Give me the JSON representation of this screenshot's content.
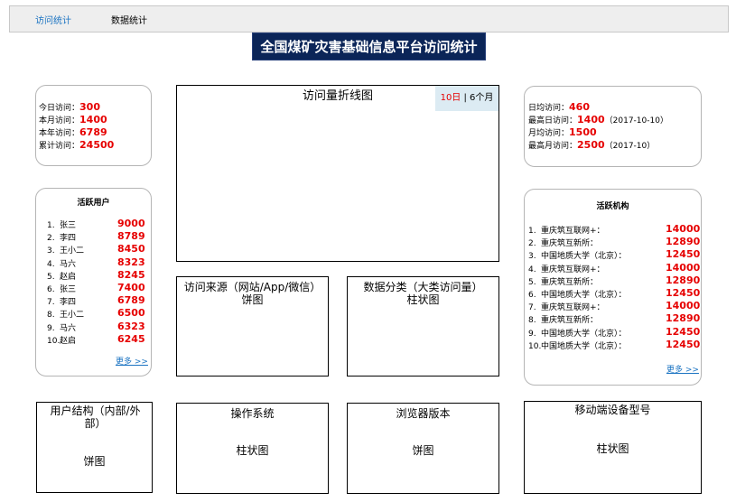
{
  "tabs": [
    {
      "label": "访问统计",
      "active": true
    },
    {
      "label": "数据统计",
      "active": false
    }
  ],
  "page_title": "全国煤矿灾害基础信息平台访问统计",
  "visits_summary": [
    {
      "label": "今日访问：",
      "value": "300"
    },
    {
      "label": "本月访问：",
      "value": "1400"
    },
    {
      "label": "本年访问：",
      "value": "6789"
    },
    {
      "label": "累计访问：",
      "value": "24500"
    }
  ],
  "averages_summary": [
    {
      "label": "日均访问：",
      "value": "460",
      "date": ""
    },
    {
      "label": "最高日访问：",
      "value": "1400",
      "date": "（2017-10-10）"
    },
    {
      "label": "月均访问：",
      "value": "1500",
      "date": ""
    },
    {
      "label": "最高月访问：",
      "value": "2500",
      "date": "（2017-10）"
    }
  ],
  "line_chart": {
    "title": "访问量折线图",
    "toggle_active": "10日",
    "toggle_sep": " | ",
    "toggle_other": "6个月"
  },
  "active_users": {
    "title": "活跃用户",
    "more": "更多 >>",
    "rows": [
      {
        "n": "1.",
        "name": "张三",
        "value": "9000"
      },
      {
        "n": "2.",
        "name": "李四",
        "value": "8789"
      },
      {
        "n": "3.",
        "name": "王小二",
        "value": "8450"
      },
      {
        "n": "4.",
        "name": "马六",
        "value": "8323"
      },
      {
        "n": "5.",
        "name": "赵启",
        "value": "8245"
      },
      {
        "n": "6.",
        "name": "张三",
        "value": "7400"
      },
      {
        "n": "7.",
        "name": "李四",
        "value": "6789"
      },
      {
        "n": "8.",
        "name": "王小二",
        "value": "6500"
      },
      {
        "n": "9.",
        "name": "马六",
        "value": "6323"
      },
      {
        "n": "10.",
        "name": "赵启",
        "value": "6245"
      }
    ]
  },
  "active_orgs": {
    "title": "活跃机构",
    "more": "更多 >>",
    "rows": [
      {
        "n": "1.",
        "name": "重庆筑互联网+：",
        "value": "14000"
      },
      {
        "n": "2.",
        "name": "重庆筑互新所：",
        "value": "12890"
      },
      {
        "n": "3.",
        "name": "中国地质大学（北京）：",
        "value": "12450"
      },
      {
        "n": "4.",
        "name": "重庆筑互联网+：",
        "value": "14000"
      },
      {
        "n": "5.",
        "name": "重庆筑互新所：",
        "value": "12890"
      },
      {
        "n": "6.",
        "name": "中国地质大学（北京）：",
        "value": "12450"
      },
      {
        "n": "7.",
        "name": "重庆筑互联网+：",
        "value": "14000"
      },
      {
        "n": "8.",
        "name": "重庆筑互新所：",
        "value": "12890"
      },
      {
        "n": "9.",
        "name": "中国地质大学（北京）：",
        "value": "12450"
      },
      {
        "n": "10.",
        "name": "中国地质大学（北京）：",
        "value": "12450"
      }
    ]
  },
  "panels": {
    "source": {
      "line1": "访问来源（网站/App/微信）",
      "line2": "饼图"
    },
    "category": {
      "line1": "数据分类（大类访问量）",
      "line2": "柱状图"
    },
    "user_structure": {
      "line1": "用户结构（内部/外部）",
      "line2": "饼图"
    },
    "os": {
      "line1": "操作系统",
      "line2": "柱状图"
    },
    "browser": {
      "line1": "浏览器版本",
      "line2": "饼图"
    },
    "mobile": {
      "line1": "移动端设备型号",
      "line2": "柱状图"
    }
  },
  "colors": {
    "accent": "#e60000",
    "title_bg": "#0b2558",
    "link": "#1a73c2",
    "toggle_bg": "#dcebf3"
  }
}
